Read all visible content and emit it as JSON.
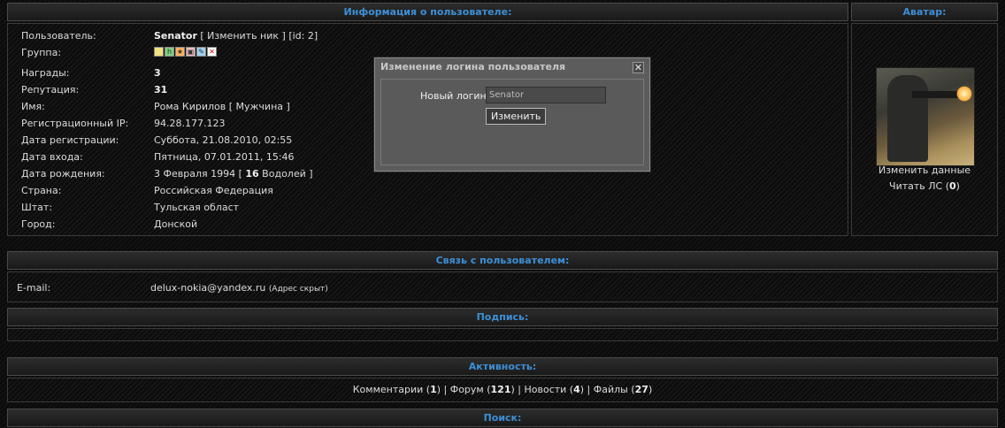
{
  "user_info": {
    "header": "Информация о пользователе:",
    "rows": [
      {
        "label": "Пользователь:",
        "value_bold": "Senator",
        "value_rest": " [ Изменить ник ] [id: 2]"
      },
      {
        "label": "Группа:"
      },
      {
        "label": "Награды:",
        "value_bold": "3"
      },
      {
        "label": "Репутация:",
        "value_bold": "31"
      },
      {
        "label": "Имя:",
        "value": "Рома Кирилов [ Мужчина ]"
      },
      {
        "label": "Регистрационный IP:",
        "value": "94.28.177.123"
      },
      {
        "label": "Дата регистрации:",
        "value": "Суббота, 21.08.2010, 02:55"
      },
      {
        "label": "Дата входа:",
        "value": "Пятница, 07.01.2011, 15:46"
      },
      {
        "label": "Дата рождения:",
        "value_pre": "3 Февраля 1994 [ ",
        "value_bold": "16",
        "value_post": " Водолей ]"
      },
      {
        "label": "Страна:",
        "value": "Российская Федерация"
      },
      {
        "label": "Штат:",
        "value": "Тульская област"
      },
      {
        "label": "Город:",
        "value": "Донской"
      }
    ],
    "group_icons": [
      "group-icon-1",
      "group-icon-2",
      "group-icon-3",
      "group-icon-4",
      "group-icon-5",
      "group-icon-6"
    ]
  },
  "avatar": {
    "header": "Аватар:",
    "edit_link": "Изменить данные",
    "pm_label": "Читать ЛС (",
    "pm_count": "0",
    "pm_close": ")"
  },
  "contact": {
    "header": "Связь с пользователем:",
    "email_label": "E-mail:",
    "email_value": "delux-nokia@yandex.ru",
    "email_note": "(Адрес скрыт)"
  },
  "signature": {
    "header": "Подпись:"
  },
  "activity": {
    "header": "Активность:",
    "items": [
      {
        "label": "Комментарии",
        "count": "1"
      },
      {
        "label": "Форум",
        "count": "121"
      },
      {
        "label": "Новости",
        "count": "4"
      },
      {
        "label": "Файлы",
        "count": "27"
      }
    ]
  },
  "search": {
    "header": "Поиск:"
  },
  "modal": {
    "title": "Изменение логина пользователя",
    "close": "✕",
    "field_label": "Новый логин:",
    "field_value": "Senator",
    "submit": "Изменить"
  }
}
